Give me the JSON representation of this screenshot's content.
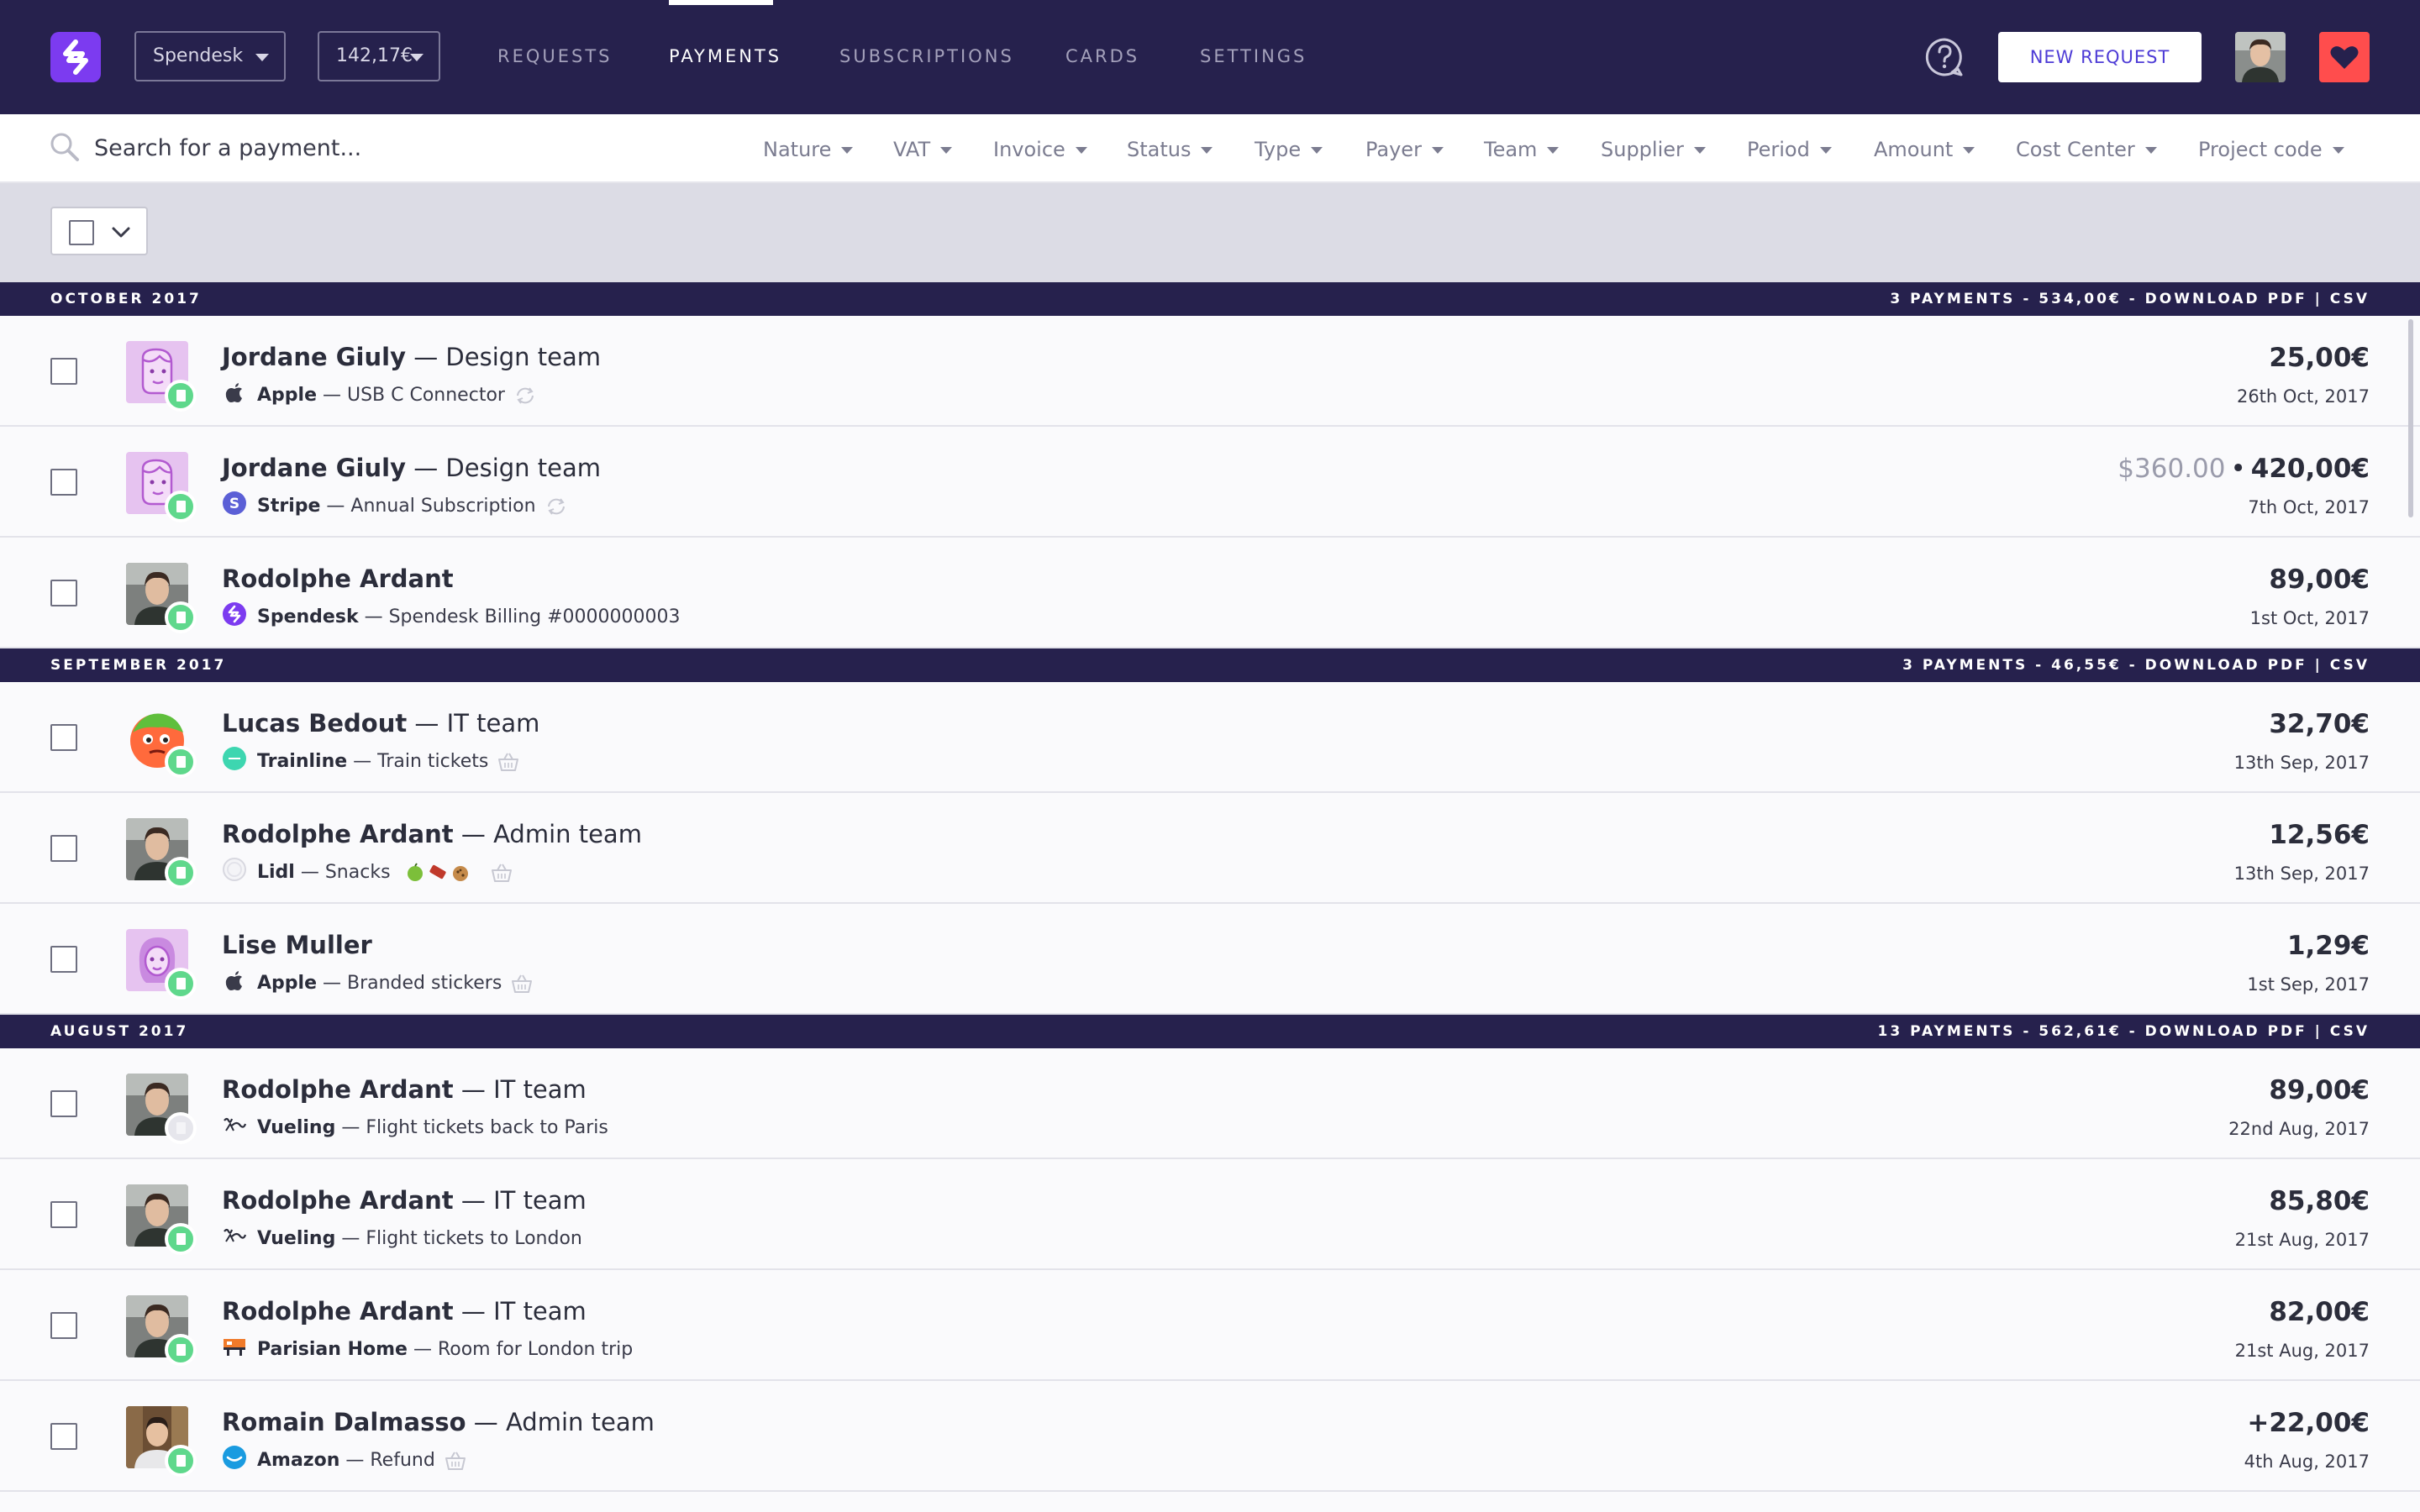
{
  "brand": {
    "accent": "#7c3bf0",
    "nav_bg": "#26214d",
    "success": "#5fd88c",
    "heart": "#ff4d4d"
  },
  "topbar": {
    "company": "Spendesk",
    "balance": "142,17€",
    "nav": [
      "REQUESTS",
      "PAYMENTS",
      "SUBSCRIPTIONS",
      "CARDS",
      "SETTINGS"
    ],
    "active_nav": "PAYMENTS",
    "new_request": "NEW REQUEST",
    "help_icon": "question-bubble-icon",
    "heart_icon": "heart-icon"
  },
  "search": {
    "placeholder": "Search for a payment...",
    "filters": [
      "Nature",
      "VAT",
      "Invoice",
      "Status",
      "Type",
      "Payer",
      "Team",
      "Supplier",
      "Period",
      "Amount",
      "Cost Center",
      "Project code"
    ]
  },
  "months": [
    {
      "label": "OCTOBER 2017",
      "summary": "3 PAYMENTS - 534,00€ - DOWNLOAD PDF | CSV",
      "payments": [
        {
          "name": "Jordane Giuly",
          "team": " — Design team",
          "supplier": "Apple",
          "desc": " — USB C Connector",
          "amount": "25,00€",
          "date": "26th Oct, 2017",
          "supplier_icon": "apple-icon",
          "extra_icon": "recurring-icon"
        },
        {
          "name": "Jordane Giuly",
          "team": " — Design team",
          "supplier": "Stripe",
          "desc": " — Annual Subscription",
          "original_amount": "$360.00",
          "amount": "420,00€",
          "date": "7th Oct, 2017",
          "supplier_icon": "stripe-icon",
          "extra_icon": "recurring-icon"
        },
        {
          "name": "Rodolphe Ardant",
          "team": "",
          "supplier": "Spendesk",
          "desc": " — Spendesk Billing #0000000003",
          "amount": "89,00€",
          "date": "1st Oct, 2017",
          "supplier_icon": "spendesk-icon"
        }
      ]
    },
    {
      "label": "SEPTEMBER 2017",
      "summary": "3 PAYMENTS - 46,55€ - DOWNLOAD PDF | CSV",
      "payments": [
        {
          "name": "Lucas Bedout",
          "team": " — IT team",
          "supplier": "Trainline",
          "desc": " — Train tickets",
          "amount": "32,70€",
          "date": "13th Sep, 2017",
          "supplier_icon": "trainline-icon",
          "extra_icon": "basket-icon"
        },
        {
          "name": "Rodolphe Ardant",
          "team": " — Admin team",
          "supplier": "Lidl",
          "desc": " — Snacks",
          "amount": "12,56€",
          "date": "13th Sep, 2017",
          "supplier_icon": "lidl-icon",
          "extra_icon": "basket-icon"
        },
        {
          "name": "Lise Muller",
          "team": "",
          "supplier": "Apple",
          "desc": " — Branded stickers",
          "amount": "1,29€",
          "date": "1st Sep, 2017",
          "supplier_icon": "apple-icon",
          "extra_icon": "basket-icon"
        }
      ]
    },
    {
      "label": "AUGUST 2017",
      "summary": "13 PAYMENTS - 562,61€ - DOWNLOAD PDF | CSV",
      "payments": [
        {
          "name": "Rodolphe Ardant",
          "team": " — IT team",
          "supplier": "Vueling",
          "desc": " — Flight tickets back to Paris",
          "amount": "89,00€",
          "date": "22nd Aug, 2017",
          "supplier_icon": "vueling-icon"
        },
        {
          "name": "Rodolphe Ardant",
          "team": " — IT team",
          "supplier": "Vueling",
          "desc": " — Flight tickets to London",
          "amount": "85,80€",
          "date": "21st Aug, 2017",
          "supplier_icon": "vueling-icon"
        },
        {
          "name": "Rodolphe Ardant",
          "team": " — IT team",
          "supplier": "Parisian Home",
          "desc": " — Room for London trip",
          "amount": "82,00€",
          "date": "21st Aug, 2017",
          "supplier_icon": "parisian-home-icon"
        },
        {
          "name": "Romain Dalmasso",
          "team": " — Admin team",
          "supplier": "Amazon",
          "desc": " — Refund",
          "amount": "+22,00€",
          "date": "4th Aug, 2017",
          "supplier_icon": "amazon-icon",
          "extra_icon": "basket-icon"
        }
      ]
    }
  ]
}
